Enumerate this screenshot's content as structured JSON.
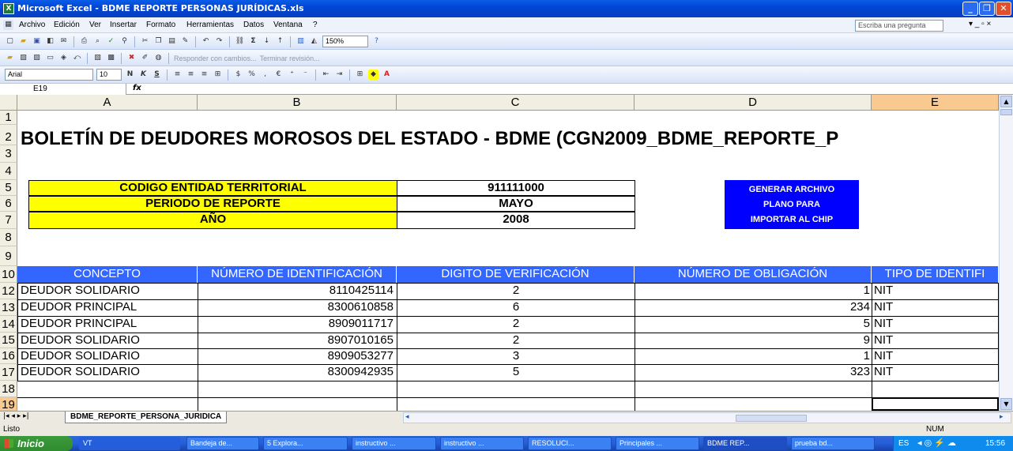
{
  "window": {
    "title": "Microsoft Excel - BDME REPORTE PERSONAS JURÍDICAS.xls"
  },
  "menu": {
    "items": [
      "Archivo",
      "Edición",
      "Ver",
      "Insertar",
      "Formato",
      "Herramientas",
      "Datos",
      "Ventana",
      "?"
    ],
    "help_placeholder": "Escriba una pregunta"
  },
  "toolbar": {
    "zoom": "150%",
    "review_respond": "Responder con cambios...",
    "review_end": "Terminar revisión...",
    "font": "Arial",
    "font_size": "10"
  },
  "formula_bar": {
    "cell_ref": "E19",
    "fx": "fx"
  },
  "columns": [
    "A",
    "B",
    "C",
    "D",
    "E"
  ],
  "rows": [
    "1",
    "2",
    "3",
    "4",
    "5",
    "6",
    "7",
    "8",
    "9",
    "10",
    "12",
    "13",
    "14",
    "15",
    "16",
    "17",
    "18",
    "19"
  ],
  "sheet": {
    "title": "BOLETÍN DE DEUDORES MOROSOS DEL ESTADO - BDME  (CGN2009_BDME_REPORTE_P",
    "params": [
      {
        "label": "CODIGO ENTIDAD TERRITORIAL",
        "value": "911111000"
      },
      {
        "label": "PERIODO DE REPORTE",
        "value": "MAYO"
      },
      {
        "label": "AÑO",
        "value": "2008"
      }
    ],
    "generate_button": [
      "GENERAR ARCHIVO",
      "PLANO PARA",
      "IMPORTAR AL CHIP"
    ],
    "headers": [
      "CONCEPTO",
      "NÚMERO DE IDENTIFICACIÓN",
      "DIGITO DE VERIFICACIÓN",
      "NÚMERO DE OBLIGACIÓN",
      "TIPO DE IDENTIFI"
    ],
    "data": [
      [
        "DEUDOR SOLIDARIO",
        "8110425114",
        "2",
        "1",
        "NIT"
      ],
      [
        "DEUDOR PRINCIPAL",
        "8300610858",
        "6",
        "234",
        "NIT"
      ],
      [
        "DEUDOR PRINCIPAL",
        "8909011717",
        "2",
        "5",
        "NIT"
      ],
      [
        "DEUDOR SOLIDARIO",
        "8907010165",
        "2",
        "9",
        "NIT"
      ],
      [
        "DEUDOR SOLIDARIO",
        "8909053277",
        "3",
        "1",
        "NIT"
      ],
      [
        "DEUDOR SOLIDARIO",
        "8300942935",
        "5",
        "323",
        "NIT"
      ]
    ]
  },
  "sheet_tab": "BDME_REPORTE_PERSONA_JURIDICA",
  "status": {
    "left": "Listo",
    "num": "NUM"
  },
  "taskbar": {
    "start": "Inicio",
    "items": [
      "VT",
      "Bandeja de...",
      "5 Explora...",
      "instructivo ...",
      "instructivo ...",
      "RESOLUCI...",
      "Principales ...",
      "BDME REP...",
      "prueba bd..."
    ],
    "lang": "ES",
    "time": "15:56"
  }
}
